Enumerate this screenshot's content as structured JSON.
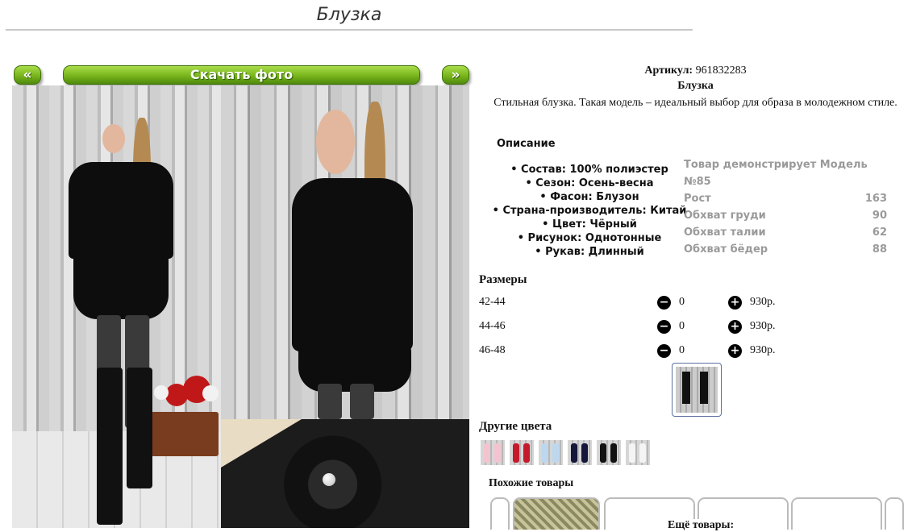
{
  "page": {
    "title": "Блузка"
  },
  "gallery": {
    "prev_label": "«",
    "download_label": "Скачать фото",
    "next_label": "»"
  },
  "product": {
    "article_label": "Артикул:",
    "article_value": "961832283",
    "name": "Блузка",
    "description": "Стильная блузка. Такая модель – идеальный выбор для образа в молодежном стиле."
  },
  "specs": {
    "heading": "Описание",
    "items": [
      "Состав: 100% полиэстер",
      "Сезон: Осень-весна",
      "Фасон: Блузон",
      "Страна-производитель: Китай",
      "Цвет: Чёрный",
      "Рисунок: Однотонные",
      "Рукав: Длинный"
    ]
  },
  "model": {
    "heading": "Товар демонстрирует Модель №85",
    "rows": [
      {
        "label": "Рост",
        "value": "163"
      },
      {
        "label": "Обхват груди",
        "value": "90"
      },
      {
        "label": "Обхват талии",
        "value": "62"
      },
      {
        "label": "Обхват бёдер",
        "value": "88"
      }
    ]
  },
  "sizes": {
    "heading": "Размеры",
    "minus_icon": "minus-circle-icon",
    "plus_icon": "plus-circle-icon",
    "rows": [
      {
        "size": "42-44",
        "qty": "0",
        "price": "930р."
      },
      {
        "size": "44-46",
        "qty": "0",
        "price": "930р."
      },
      {
        "size": "46-48",
        "qty": "0",
        "price": "930р."
      }
    ]
  },
  "other_colors": {
    "heading": "Другие цвета",
    "swatches": [
      "#f3c4cf",
      "#c41a2c",
      "#bcd7ee",
      "#15183a",
      "#121212",
      "#f4f4f4"
    ]
  },
  "similar": {
    "heading": "Похожие товары",
    "more_label": "Ещё товары:"
  },
  "colors": {
    "button_green": "#79b51c",
    "model_text": "#9a9a9a",
    "thumb_border": "#5c6fa0"
  }
}
